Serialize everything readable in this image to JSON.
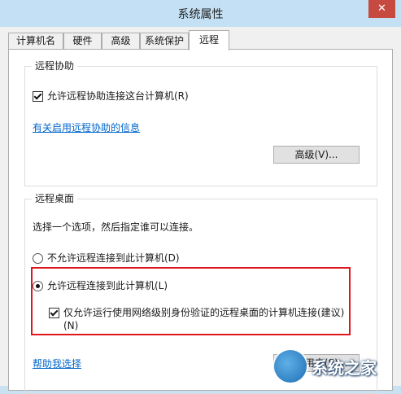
{
  "window": {
    "title": "系统属性",
    "close_glyph": "✕",
    "accent_close": "#c74a41"
  },
  "tabs": [
    {
      "label": "计算机名",
      "active": false
    },
    {
      "label": "硬件",
      "active": false
    },
    {
      "label": "高级",
      "active": false
    },
    {
      "label": "系统保护",
      "active": false
    },
    {
      "label": "远程",
      "active": true
    }
  ],
  "remote_assistance": {
    "group_title": "远程协助",
    "allow_checkbox_label": "允许远程协助连接这台计算机(R)",
    "allow_checked": true,
    "info_link": "有关启用远程协助的信息",
    "advanced_button": "高级(V)..."
  },
  "remote_desktop": {
    "group_title": "远程桌面",
    "instruction": "选择一个选项，然后指定谁可以连接。",
    "option_deny": "不允许远程连接到此计算机(D)",
    "option_allow": "允许远程连接到此计算机(L)",
    "selected": "allow",
    "nla_checkbox_line1": "仅允许运行使用网络级别身份验证的远程桌面的计算机连接(建议)",
    "nla_checkbox_line2": "(N)",
    "nla_checked": true,
    "help_link": "帮助我选择",
    "select_users_button": "选择用户(S)..."
  },
  "watermark": {
    "text": "系统之家"
  }
}
